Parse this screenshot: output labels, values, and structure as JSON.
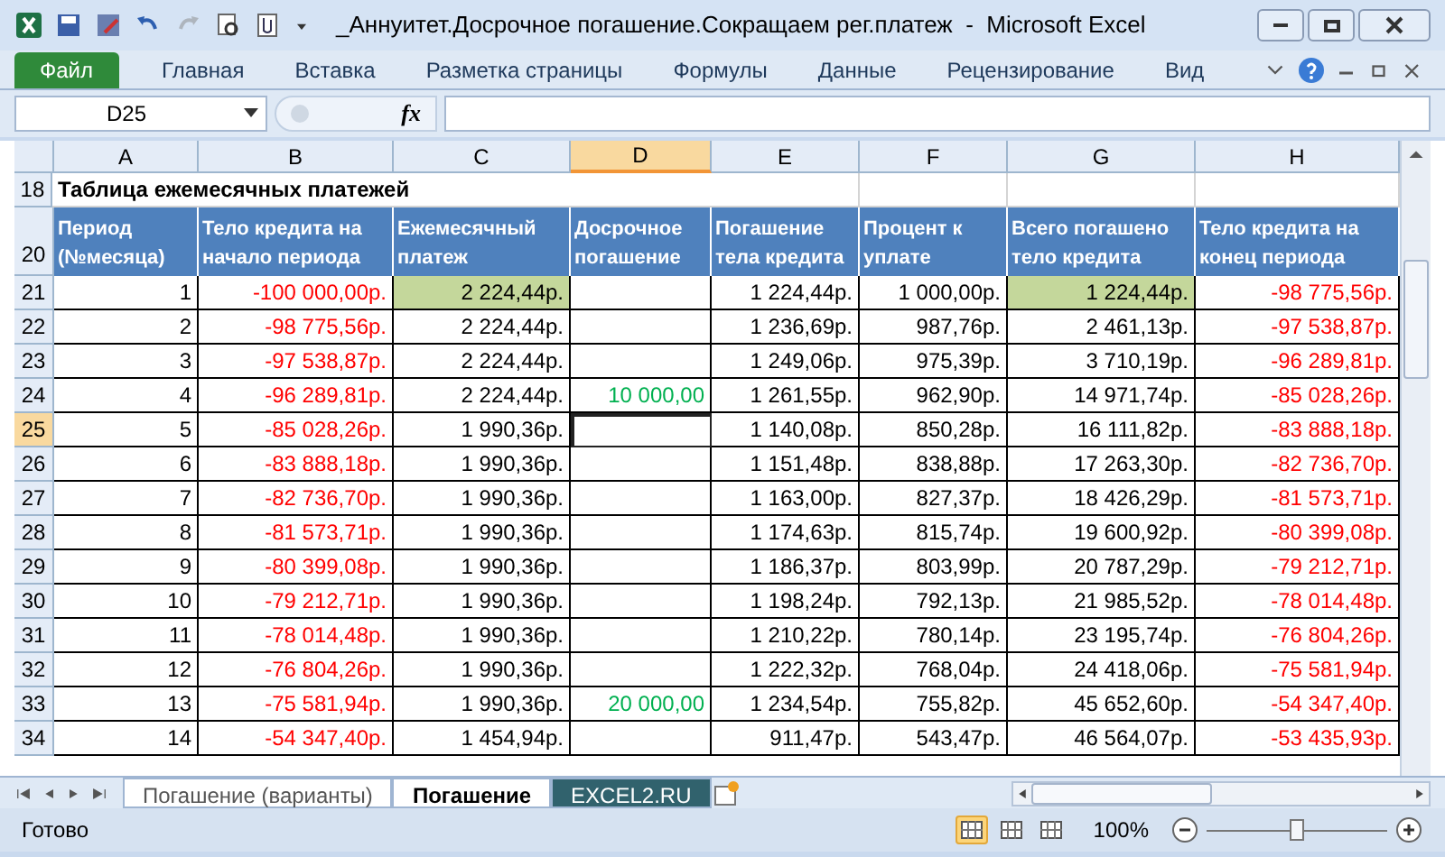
{
  "window": {
    "title": "_Аннуитет.Досрочное погашение.Сокращаем рег.платеж  -  Microsoft Excel"
  },
  "ribbon_tabs": [
    {
      "label": "Файл",
      "kind": "file"
    },
    {
      "label": "Главная",
      "kind": "tab"
    },
    {
      "label": "Вставка",
      "kind": "tab"
    },
    {
      "label": "Разметка страницы",
      "kind": "tab"
    },
    {
      "label": "Формулы",
      "kind": "tab"
    },
    {
      "label": "Данные",
      "kind": "tab"
    },
    {
      "label": "Рецензирование",
      "kind": "tab"
    },
    {
      "label": "Вид",
      "kind": "tab"
    }
  ],
  "formula_bar": {
    "name_box": "D25",
    "fx": "fx"
  },
  "columns": [
    {
      "label": "A",
      "selected": false
    },
    {
      "label": "B",
      "selected": false
    },
    {
      "label": "C",
      "selected": false
    },
    {
      "label": "D",
      "selected": true
    },
    {
      "label": "E",
      "selected": false
    },
    {
      "label": "F",
      "selected": false
    },
    {
      "label": "G",
      "selected": false
    },
    {
      "label": "H",
      "selected": false
    }
  ],
  "title_row": {
    "row": "18",
    "text": "Таблица ежемесячных платежей"
  },
  "header_row": {
    "row": "20",
    "cells": [
      "Период (№месяца)",
      "Тело кредита на начало периода",
      "Ежемесячный платеж",
      "Досрочное погашение",
      "Погашение тела кредита",
      "Процент к уплате",
      "Всего погашено тело кредита",
      "Тело кредита на конец периода"
    ]
  },
  "rows": [
    {
      "row": "21",
      "selected": false,
      "cells": [
        {
          "text": "1",
          "color": "#000000",
          "highlighted": false
        },
        {
          "text": "-100 000,00р.",
          "color": "#ff0000",
          "highlighted": false
        },
        {
          "text": "2 224,44р.",
          "color": "#000000",
          "highlighted": true
        },
        {
          "highlighted": false
        },
        {
          "text": "1 224,44р.",
          "color": "#000000",
          "highlighted": false
        },
        {
          "text": "1 000,00р.",
          "color": "#000000",
          "highlighted": false
        },
        {
          "text": "1 224,44р.",
          "color": "#000000",
          "highlighted": true
        },
        {
          "text": "-98 775,56р.",
          "color": "#ff0000",
          "highlighted": false
        }
      ]
    },
    {
      "row": "22",
      "selected": false,
      "cells": [
        {
          "text": "2",
          "color": "#000000",
          "highlighted": false
        },
        {
          "text": "-98 775,56р.",
          "color": "#ff0000",
          "highlighted": false
        },
        {
          "text": "2 224,44р.",
          "color": "#000000",
          "highlighted": false
        },
        {
          "highlighted": false
        },
        {
          "text": "1 236,69р.",
          "color": "#000000",
          "highlighted": false
        },
        {
          "text": "987,76р.",
          "color": "#000000",
          "highlighted": false
        },
        {
          "text": "2 461,13р.",
          "color": "#000000",
          "highlighted": false
        },
        {
          "text": "-97 538,87р.",
          "color": "#ff0000",
          "highlighted": false
        }
      ]
    },
    {
      "row": "23",
      "selected": false,
      "cells": [
        {
          "text": "3",
          "color": "#000000",
          "highlighted": false
        },
        {
          "text": "-97 538,87р.",
          "color": "#ff0000",
          "highlighted": false
        },
        {
          "text": "2 224,44р.",
          "color": "#000000",
          "highlighted": false
        },
        {
          "highlighted": false
        },
        {
          "text": "1 249,06р.",
          "color": "#000000",
          "highlighted": false
        },
        {
          "text": "975,39р.",
          "color": "#000000",
          "highlighted": false
        },
        {
          "text": "3 710,19р.",
          "color": "#000000",
          "highlighted": false
        },
        {
          "text": "-96 289,81р.",
          "color": "#ff0000",
          "highlighted": false
        }
      ]
    },
    {
      "row": "24",
      "selected": false,
      "cells": [
        {
          "text": "4",
          "color": "#000000",
          "highlighted": false
        },
        {
          "text": "-96 289,81р.",
          "color": "#ff0000",
          "highlighted": false
        },
        {
          "text": "2 224,44р.",
          "color": "#000000",
          "highlighted": false
        },
        {
          "text": "10 000,00",
          "color": "#00b050",
          "highlighted": false
        },
        {
          "text": "1 261,55р.",
          "color": "#000000",
          "highlighted": false
        },
        {
          "text": "962,90р.",
          "color": "#000000",
          "highlighted": false
        },
        {
          "text": "14 971,74р.",
          "color": "#000000",
          "highlighted": false
        },
        {
          "text": "-85 028,26р.",
          "color": "#ff0000",
          "highlighted": false
        }
      ]
    },
    {
      "row": "25",
      "selected": true,
      "cells": [
        {
          "text": "5",
          "color": "#000000",
          "highlighted": false
        },
        {
          "text": "-85 028,26р.",
          "color": "#ff0000",
          "highlighted": false
        },
        {
          "text": "1 990,36р.",
          "color": "#000000",
          "highlighted": false
        },
        {
          "highlighted": false
        },
        {
          "text": "1 140,08р.",
          "color": "#000000",
          "highlighted": false
        },
        {
          "text": "850,28р.",
          "color": "#000000",
          "highlighted": false
        },
        {
          "text": "16 111,82р.",
          "color": "#000000",
          "highlighted": false
        },
        {
          "text": "-83 888,18р.",
          "color": "#ff0000",
          "highlighted": false
        }
      ]
    },
    {
      "row": "26",
      "selected": false,
      "cells": [
        {
          "text": "6",
          "color": "#000000",
          "highlighted": false
        },
        {
          "text": "-83 888,18р.",
          "color": "#ff0000",
          "highlighted": false
        },
        {
          "text": "1 990,36р.",
          "color": "#000000",
          "highlighted": false
        },
        {
          "highlighted": false
        },
        {
          "text": "1 151,48р.",
          "color": "#000000",
          "highlighted": false
        },
        {
          "text": "838,88р.",
          "color": "#000000",
          "highlighted": false
        },
        {
          "text": "17 263,30р.",
          "color": "#000000",
          "highlighted": false
        },
        {
          "text": "-82 736,70р.",
          "color": "#ff0000",
          "highlighted": false
        }
      ]
    },
    {
      "row": "27",
      "selected": false,
      "cells": [
        {
          "text": "7",
          "color": "#000000",
          "highlighted": false
        },
        {
          "text": "-82 736,70р.",
          "color": "#ff0000",
          "highlighted": false
        },
        {
          "text": "1 990,36р.",
          "color": "#000000",
          "highlighted": false
        },
        {
          "highlighted": false
        },
        {
          "text": "1 163,00р.",
          "color": "#000000",
          "highlighted": false
        },
        {
          "text": "827,37р.",
          "color": "#000000",
          "highlighted": false
        },
        {
          "text": "18 426,29р.",
          "color": "#000000",
          "highlighted": false
        },
        {
          "text": "-81 573,71р.",
          "color": "#ff0000",
          "highlighted": false
        }
      ]
    },
    {
      "row": "28",
      "selected": false,
      "cells": [
        {
          "text": "8",
          "color": "#000000",
          "highlighted": false
        },
        {
          "text": "-81 573,71р.",
          "color": "#ff0000",
          "highlighted": false
        },
        {
          "text": "1 990,36р.",
          "color": "#000000",
          "highlighted": false
        },
        {
          "highlighted": false
        },
        {
          "text": "1 174,63р.",
          "color": "#000000",
          "highlighted": false
        },
        {
          "text": "815,74р.",
          "color": "#000000",
          "highlighted": false
        },
        {
          "text": "19 600,92р.",
          "color": "#000000",
          "highlighted": false
        },
        {
          "text": "-80 399,08р.",
          "color": "#ff0000",
          "highlighted": false
        }
      ]
    },
    {
      "row": "29",
      "selected": false,
      "cells": [
        {
          "text": "9",
          "color": "#000000",
          "highlighted": false
        },
        {
          "text": "-80 399,08р.",
          "color": "#ff0000",
          "highlighted": false
        },
        {
          "text": "1 990,36р.",
          "color": "#000000",
          "highlighted": false
        },
        {
          "highlighted": false
        },
        {
          "text": "1 186,37р.",
          "color": "#000000",
          "highlighted": false
        },
        {
          "text": "803,99р.",
          "color": "#000000",
          "highlighted": false
        },
        {
          "text": "20 787,29р.",
          "color": "#000000",
          "highlighted": false
        },
        {
          "text": "-79 212,71р.",
          "color": "#ff0000",
          "highlighted": false
        }
      ]
    },
    {
      "row": "30",
      "selected": false,
      "cells": [
        {
          "text": "10",
          "color": "#000000",
          "highlighted": false
        },
        {
          "text": "-79 212,71р.",
          "color": "#ff0000",
          "highlighted": false
        },
        {
          "text": "1 990,36р.",
          "color": "#000000",
          "highlighted": false
        },
        {
          "highlighted": false
        },
        {
          "text": "1 198,24р.",
          "color": "#000000",
          "highlighted": false
        },
        {
          "text": "792,13р.",
          "color": "#000000",
          "highlighted": false
        },
        {
          "text": "21 985,52р.",
          "color": "#000000",
          "highlighted": false
        },
        {
          "text": "-78 014,48р.",
          "color": "#ff0000",
          "highlighted": false
        }
      ]
    },
    {
      "row": "31",
      "selected": false,
      "cells": [
        {
          "text": "11",
          "color": "#000000",
          "highlighted": false
        },
        {
          "text": "-78 014,48р.",
          "color": "#ff0000",
          "highlighted": false
        },
        {
          "text": "1 990,36р.",
          "color": "#000000",
          "highlighted": false
        },
        {
          "highlighted": false
        },
        {
          "text": "1 210,22р.",
          "color": "#000000",
          "highlighted": false
        },
        {
          "text": "780,14р.",
          "color": "#000000",
          "highlighted": false
        },
        {
          "text": "23 195,74р.",
          "color": "#000000",
          "highlighted": false
        },
        {
          "text": "-76 804,26р.",
          "color": "#ff0000",
          "highlighted": false
        }
      ]
    },
    {
      "row": "32",
      "selected": false,
      "cells": [
        {
          "text": "12",
          "color": "#000000",
          "highlighted": false
        },
        {
          "text": "-76 804,26р.",
          "color": "#ff0000",
          "highlighted": false
        },
        {
          "text": "1 990,36р.",
          "color": "#000000",
          "highlighted": false
        },
        {
          "highlighted": false
        },
        {
          "text": "1 222,32р.",
          "color": "#000000",
          "highlighted": false
        },
        {
          "text": "768,04р.",
          "color": "#000000",
          "highlighted": false
        },
        {
          "text": "24 418,06р.",
          "color": "#000000",
          "highlighted": false
        },
        {
          "text": "-75 581,94р.",
          "color": "#ff0000",
          "highlighted": false
        }
      ]
    },
    {
      "row": "33",
      "selected": false,
      "cells": [
        {
          "text": "13",
          "color": "#000000",
          "highlighted": false
        },
        {
          "text": "-75 581,94р.",
          "color": "#ff0000",
          "highlighted": false
        },
        {
          "text": "1 990,36р.",
          "color": "#000000",
          "highlighted": false
        },
        {
          "text": "20 000,00",
          "color": "#00b050",
          "highlighted": false
        },
        {
          "text": "1 234,54р.",
          "color": "#000000",
          "highlighted": false
        },
        {
          "text": "755,82р.",
          "color": "#000000",
          "highlighted": false
        },
        {
          "text": "45 652,60р.",
          "color": "#000000",
          "highlighted": false
        },
        {
          "text": "-54 347,40р.",
          "color": "#ff0000",
          "highlighted": false
        }
      ]
    },
    {
      "row": "34",
      "selected": false,
      "cells": [
        {
          "text": "14",
          "color": "#000000",
          "highlighted": false
        },
        {
          "text": "-54 347,40р.",
          "color": "#ff0000",
          "highlighted": false
        },
        {
          "text": "1 454,94р.",
          "color": "#000000",
          "highlighted": false
        },
        {
          "highlighted": false
        },
        {
          "text": "911,47р.",
          "color": "#000000",
          "highlighted": false
        },
        {
          "text": "543,47р.",
          "color": "#000000",
          "highlighted": false
        },
        {
          "text": "46 564,07р.",
          "color": "#000000",
          "highlighted": false
        },
        {
          "text": "-53 435,93р.",
          "color": "#ff0000",
          "highlighted": false
        }
      ]
    }
  ],
  "sheet_tabs": [
    {
      "label": "Погашение (варианты)",
      "selected": false,
      "color": "#ffffff"
    },
    {
      "label": "Погашение",
      "selected": true,
      "color": "#ffffff"
    },
    {
      "label": "EXCEL2.RU",
      "selected": false,
      "color": "#31626d"
    }
  ],
  "status_bar": {
    "text": "Готово",
    "views": [
      {
        "selected": true
      },
      {
        "selected": false
      },
      {
        "selected": false
      }
    ],
    "zoom": "100%",
    "zoom_slider": {
      "level": 0.5
    }
  }
}
